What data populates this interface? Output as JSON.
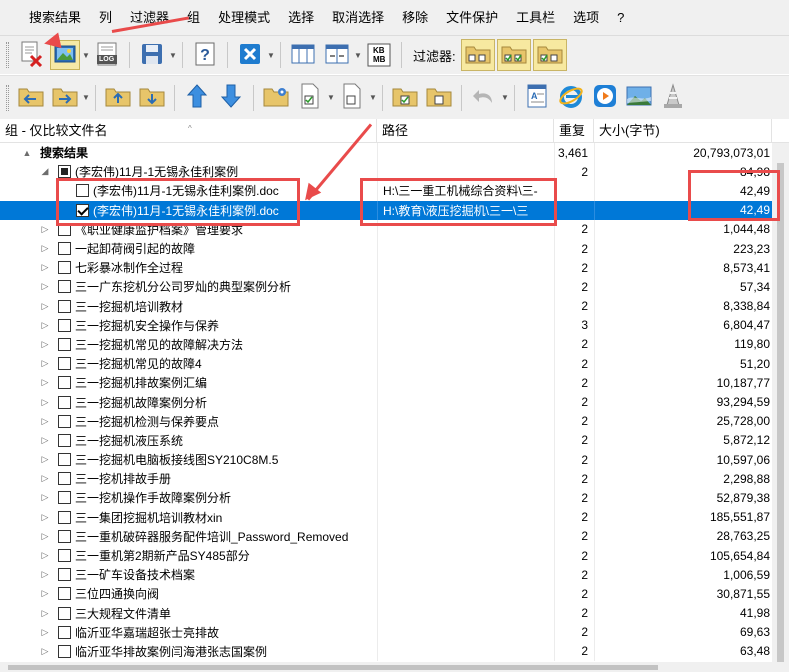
{
  "menu": [
    "搜索结果",
    "列",
    "过滤器",
    "组",
    "处理模式",
    "选择",
    "取消选择",
    "移除",
    "文件保护",
    "工具栏",
    "选项",
    "?"
  ],
  "toolbar": {
    "filter_label": "过滤器:",
    "log_label": "LOG",
    "kb_label": "KB",
    "mb_label": "MB"
  },
  "columns": {
    "name": "组 - 仅比较文件名",
    "path": "路径",
    "dup": "重复",
    "size": "大小(字节)"
  },
  "rows": [
    {
      "level": 0,
      "expander": "▲",
      "checkbox": "none",
      "name": "搜索结果",
      "bold": true,
      "path": "",
      "dup": "3,461",
      "size": "20,793,073,01"
    },
    {
      "level": 1,
      "expander": "◢",
      "checkbox": "partial",
      "name": "(李宏伟)11月-1无锡永佳利案例",
      "path": "",
      "dup": "2",
      "size": "84,98"
    },
    {
      "level": 2,
      "expander": "",
      "checkbox": "unchecked",
      "name": "(李宏伟)11月-1无锡永佳利案例.doc",
      "path": "H:\\三一重工机械综合资料\\三-",
      "dup": "",
      "size": "42,49"
    },
    {
      "level": 2,
      "expander": "",
      "checkbox": "checked",
      "selected": true,
      "name": "(李宏伟)11月-1无锡永佳利案例.doc",
      "path": "H:\\教育\\液压挖掘机\\三一\\三",
      "dup": "",
      "size": "42,49"
    },
    {
      "level": 1,
      "expander": "▷",
      "checkbox": "unchecked",
      "name": "《职业健康监护档案》管理要求",
      "path": "",
      "dup": "2",
      "size": "1,044,48"
    },
    {
      "level": 1,
      "expander": "▷",
      "checkbox": "unchecked",
      "name": "一起卸荷阀引起的故障",
      "path": "",
      "dup": "2",
      "size": "223,23"
    },
    {
      "level": 1,
      "expander": "▷",
      "checkbox": "unchecked",
      "name": "七彩暴冰制作全过程",
      "path": "",
      "dup": "2",
      "size": "8,573,41"
    },
    {
      "level": 1,
      "expander": "▷",
      "checkbox": "unchecked",
      "name": "三一广东挖机分公司罗灿的典型案例分析",
      "path": "",
      "dup": "2",
      "size": "57,34"
    },
    {
      "level": 1,
      "expander": "▷",
      "checkbox": "unchecked",
      "name": "三一挖掘机培训教材",
      "path": "",
      "dup": "2",
      "size": "8,338,84"
    },
    {
      "level": 1,
      "expander": "▷",
      "checkbox": "unchecked",
      "name": "三一挖掘机安全操作与保养",
      "path": "",
      "dup": "3",
      "size": "6,804,47"
    },
    {
      "level": 1,
      "expander": "▷",
      "checkbox": "unchecked",
      "name": "三一挖掘机常见的故障解决方法",
      "path": "",
      "dup": "2",
      "size": "119,80"
    },
    {
      "level": 1,
      "expander": "▷",
      "checkbox": "unchecked",
      "name": "三一挖掘机常见的故障4",
      "path": "",
      "dup": "2",
      "size": "51,20"
    },
    {
      "level": 1,
      "expander": "▷",
      "checkbox": "unchecked",
      "name": "三一挖掘机排故案例汇编",
      "path": "",
      "dup": "2",
      "size": "10,187,77"
    },
    {
      "level": 1,
      "expander": "▷",
      "checkbox": "unchecked",
      "name": "三一挖掘机故障案例分析",
      "path": "",
      "dup": "2",
      "size": "93,294,59"
    },
    {
      "level": 1,
      "expander": "▷",
      "checkbox": "unchecked",
      "name": "三一挖掘机检测与保养要点",
      "path": "",
      "dup": "2",
      "size": "25,728,00"
    },
    {
      "level": 1,
      "expander": "▷",
      "checkbox": "unchecked",
      "name": "三一挖掘机液压系统",
      "path": "",
      "dup": "2",
      "size": "5,872,12"
    },
    {
      "level": 1,
      "expander": "▷",
      "checkbox": "unchecked",
      "name": "三一挖掘机电脑板接线图SY210C8M.5",
      "path": "",
      "dup": "2",
      "size": "10,597,06"
    },
    {
      "level": 1,
      "expander": "▷",
      "checkbox": "unchecked",
      "name": "三一挖机排故手册",
      "path": "",
      "dup": "2",
      "size": "2,298,88"
    },
    {
      "level": 1,
      "expander": "▷",
      "checkbox": "unchecked",
      "name": "三一挖机操作手故障案例分析",
      "path": "",
      "dup": "2",
      "size": "52,879,38"
    },
    {
      "level": 1,
      "expander": "▷",
      "checkbox": "unchecked",
      "name": "三一集团挖掘机培训教材xin",
      "path": "",
      "dup": "2",
      "size": "185,551,87"
    },
    {
      "level": 1,
      "expander": "▷",
      "checkbox": "unchecked",
      "name": "三一重机破碎器服务配件培训_Password_Removed",
      "path": "",
      "dup": "2",
      "size": "28,763,25"
    },
    {
      "level": 1,
      "expander": "▷",
      "checkbox": "unchecked",
      "name": "三一重机第2期新产品SY485部分",
      "path": "",
      "dup": "2",
      "size": "105,654,84"
    },
    {
      "level": 1,
      "expander": "▷",
      "checkbox": "unchecked",
      "name": "三一矿车设备技术档案",
      "path": "",
      "dup": "2",
      "size": "1,006,59"
    },
    {
      "level": 1,
      "expander": "▷",
      "checkbox": "unchecked",
      "name": "三位四通换向阀",
      "path": "",
      "dup": "2",
      "size": "30,871,55"
    },
    {
      "level": 1,
      "expander": "▷",
      "checkbox": "unchecked",
      "name": "三大规程文件清单",
      "path": "",
      "dup": "2",
      "size": "41,98"
    },
    {
      "level": 1,
      "expander": "▷",
      "checkbox": "unchecked",
      "name": "临沂亚华嘉瑞超张士亮排故",
      "path": "",
      "dup": "2",
      "size": "69,63"
    },
    {
      "level": 1,
      "expander": "▷",
      "checkbox": "unchecked",
      "name": "临沂亚华排故案例闫海港张志国案例",
      "path": "",
      "dup": "2",
      "size": "63,48"
    }
  ],
  "colors": {
    "accent": "#0078d7",
    "annotation": "#e94b4b",
    "toolbar_bg": "#f0f0f0",
    "filter_button": "#f7e9a0"
  }
}
